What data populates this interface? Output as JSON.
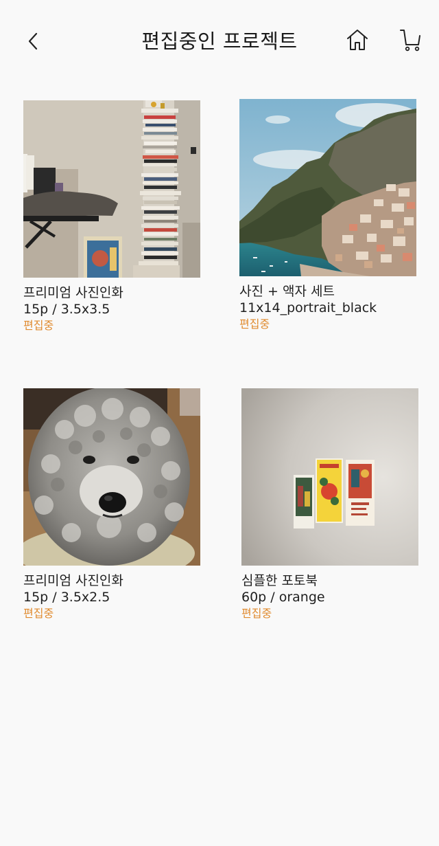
{
  "header": {
    "title": "편집중인 프로젝트"
  },
  "icons": {
    "back": "chevron-left-icon",
    "home": "home-icon",
    "cart": "cart-icon"
  },
  "colors": {
    "status": "#e08a2e",
    "background": "#f9f9f9"
  },
  "projects": [
    {
      "name": "프리미엄 사진인화",
      "spec": "15p / 3.5x3.5",
      "status": "편집중"
    },
    {
      "name": "사진 + 액자 세트",
      "spec": "11x14_portrait_black",
      "status": "편집중"
    },
    {
      "name": "프리미엄 사진인화",
      "spec": "15p / 3.5x2.5",
      "status": "편집중"
    },
    {
      "name": "심플한 포토북",
      "spec": "60p / orange",
      "status": "편집중"
    }
  ]
}
